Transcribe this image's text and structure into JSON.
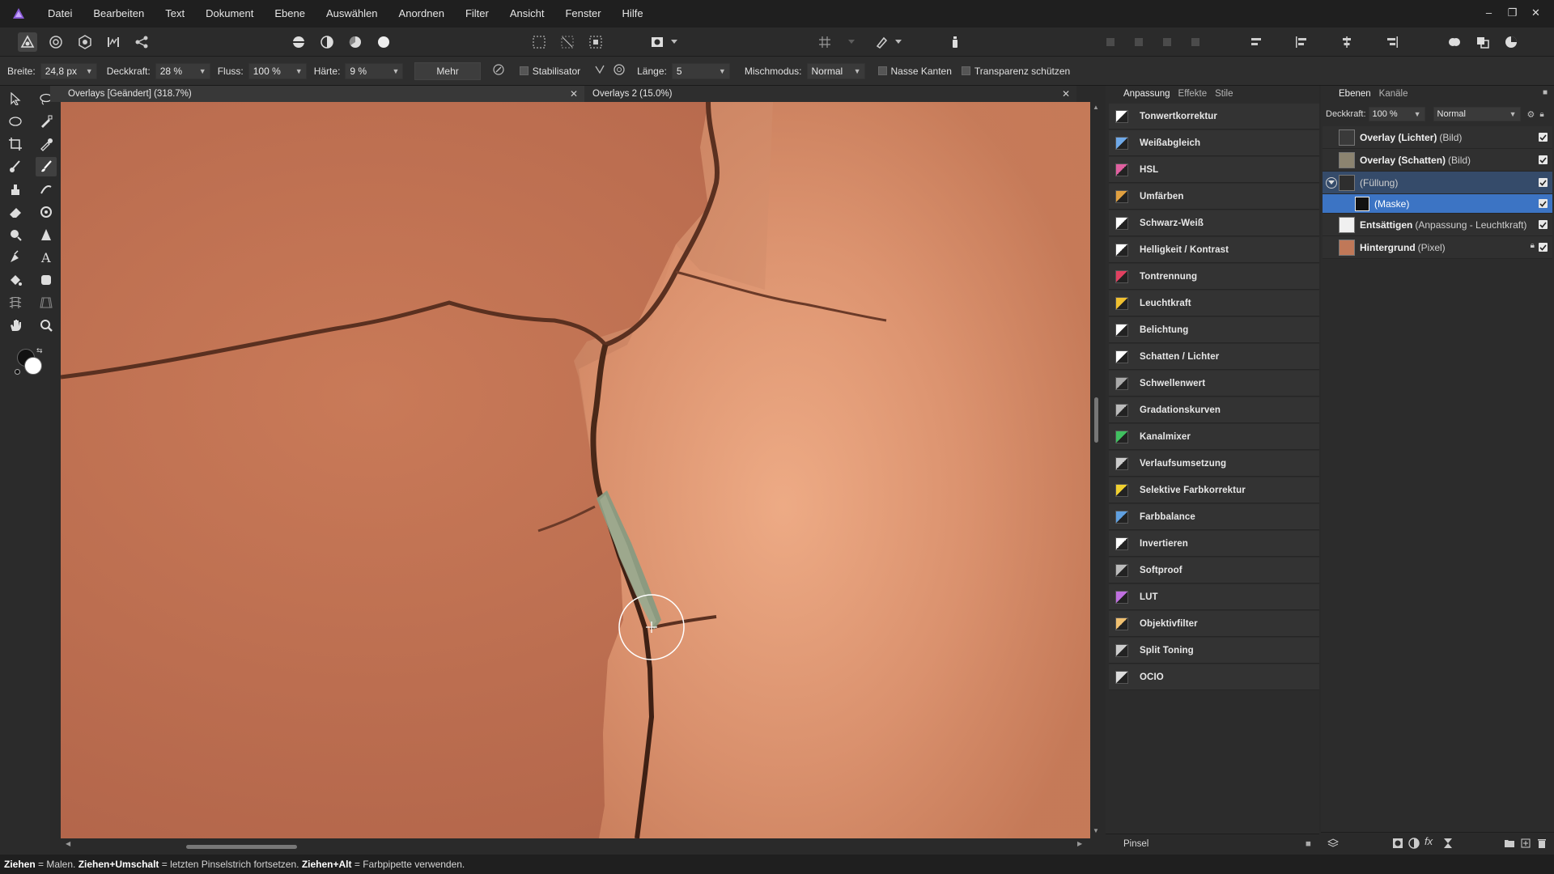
{
  "app": {
    "menu": [
      "Datei",
      "Bearbeiten",
      "Text",
      "Dokument",
      "Ebene",
      "Auswählen",
      "Anordnen",
      "Filter",
      "Ansicht",
      "Fenster",
      "Hilfe"
    ],
    "window_controls": [
      "–",
      "❐",
      "✕"
    ]
  },
  "context": {
    "breite_label": "Breite:",
    "breite_value": "24,8 px",
    "deckkraft_label": "Deckkraft:",
    "deckkraft_value": "28 %",
    "fluss_label": "Fluss:",
    "fluss_value": "100 %",
    "haerte_label": "Härte:",
    "haerte_value": "9 %",
    "mehr_label": "Mehr",
    "stabilisator_label": "Stabilisator",
    "laenge_label": "Länge:",
    "laenge_value": "5",
    "mischmodus_label": "Mischmodus:",
    "mischmodus_value": "Normal",
    "nasse_kanten_label": "Nasse Kanten",
    "transparenz_label": "Transparenz schützen"
  },
  "documents": {
    "tab1": "Overlays [Geändert] (318.7%)",
    "tab2": "Overlays 2 (15.0%)",
    "close": "✕"
  },
  "adjustments": {
    "tabs": [
      "Anpassung",
      "Effekte",
      "Stile"
    ],
    "items": [
      {
        "label": "Tonwertkorrektur",
        "color": "#ffffff"
      },
      {
        "label": "Weißabgleich",
        "color": "#6fa9e8"
      },
      {
        "label": "HSL",
        "color": "#e060a0"
      },
      {
        "label": "Umfärben",
        "color": "#e0a040"
      },
      {
        "label": "Schwarz-Weiß",
        "color": "#ffffff"
      },
      {
        "label": "Helligkeit / Kontrast",
        "color": "#ffffff"
      },
      {
        "label": "Tontrennung",
        "color": "#e04060"
      },
      {
        "label": "Leuchtkraft",
        "color": "#f0c030"
      },
      {
        "label": "Belichtung",
        "color": "#ffffff"
      },
      {
        "label": "Schatten / Lichter",
        "color": "#ffffff"
      },
      {
        "label": "Schwellenwert",
        "color": "#aaaaaa"
      },
      {
        "label": "Gradationskurven",
        "color": "#bbbbbb"
      },
      {
        "label": "Kanalmixer",
        "color": "#40c060"
      },
      {
        "label": "Verlaufsumsetzung",
        "color": "#cccccc"
      },
      {
        "label": "Selektive Farbkorrektur",
        "color": "#f0d030"
      },
      {
        "label": "Farbbalance",
        "color": "#60a0e0"
      },
      {
        "label": "Invertieren",
        "color": "#ffffff"
      },
      {
        "label": "Softproof",
        "color": "#bbbbbb"
      },
      {
        "label": "LUT",
        "color": "#c070e0"
      },
      {
        "label": "Objektivfilter",
        "color": "#f0c070"
      },
      {
        "label": "Split Toning",
        "color": "#cccccc"
      },
      {
        "label": "OCIO",
        "color": "#dddddd"
      }
    ],
    "footer": "Pinsel"
  },
  "layers": {
    "tabs": [
      "Ebenen",
      "Kanäle"
    ],
    "opacity_label": "Deckkraft:",
    "opacity_value": "100 %",
    "blend_value": "Normal",
    "rows": [
      {
        "name": "Overlay (Lichter)",
        "type": "(Bild)"
      },
      {
        "name": "Overlay (Schatten)",
        "type": "(Bild)"
      },
      {
        "name": "",
        "type": "(Füllung)"
      },
      {
        "name": "",
        "type": "(Maske)"
      },
      {
        "name": "Entsättigen",
        "type": "(Anpassung - Leuchtkraft)"
      },
      {
        "name": "Hintergrund",
        "type": "(Pixel)"
      }
    ]
  },
  "status": {
    "a1": "Ziehen",
    "t1": " = Malen. ",
    "a2": "Ziehen+Umschalt",
    "t2": " = letzten Pinselstrich fortsetzen. ",
    "a3": "Ziehen+Alt",
    "t3": " = Farbpipette verwenden."
  }
}
